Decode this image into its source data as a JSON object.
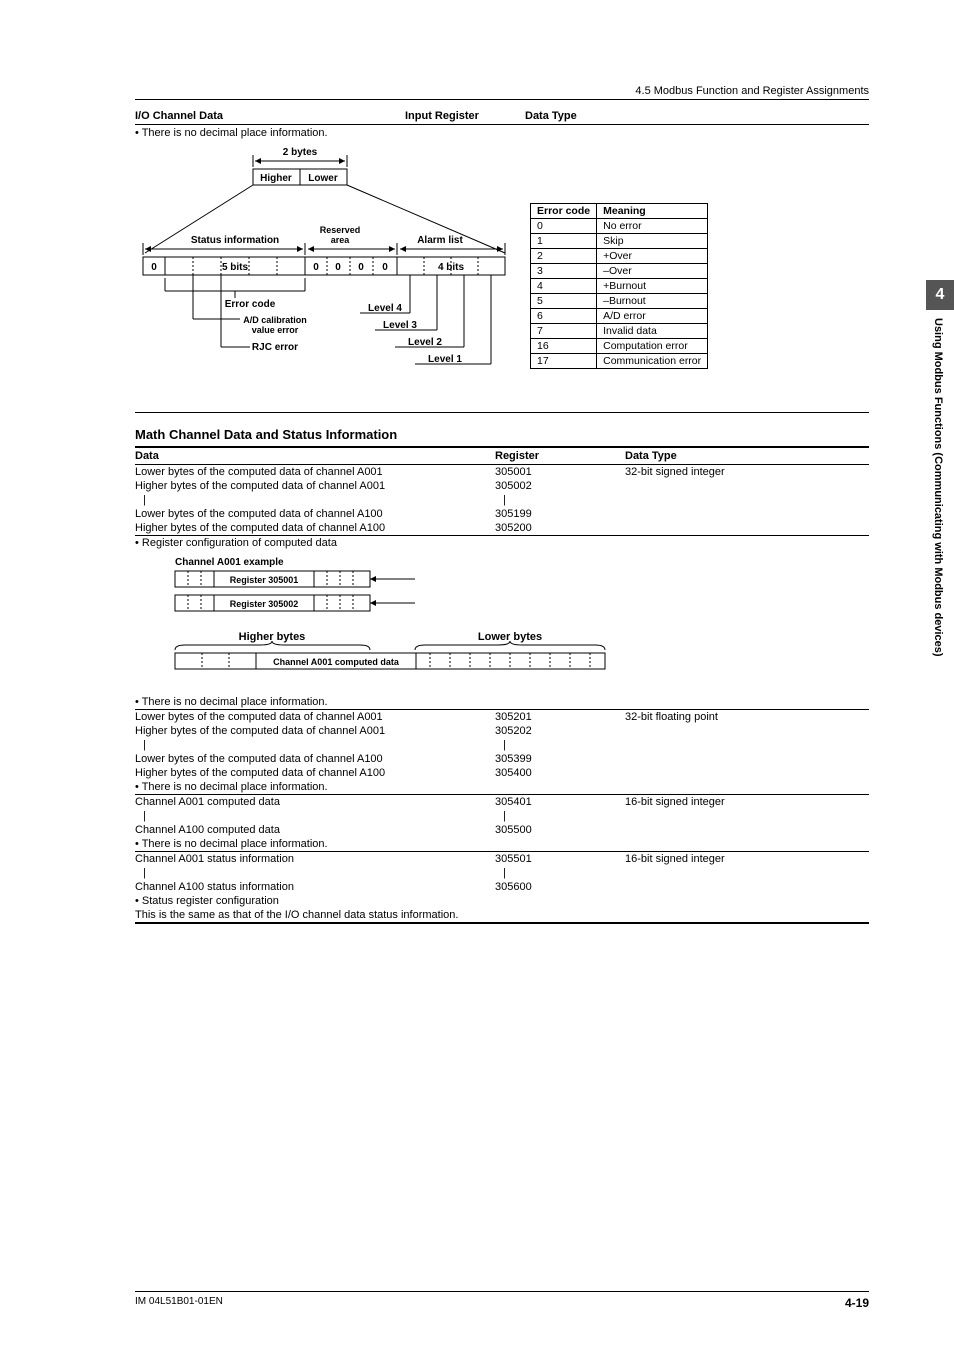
{
  "header": {
    "section_ref": "4.5  Modbus Function and Register Assignments"
  },
  "side_tab": {
    "number": "4",
    "label": "Using Modbus Functions (Communicating with Modbus devices)"
  },
  "io_section": {
    "title_col1": "I/O Channel Data",
    "title_col2": "Input Register",
    "title_col3": "Data Type",
    "note1": "• There is no decimal place information.",
    "diagram": {
      "bytes_label": "2 bytes",
      "higher": "Higher",
      "lower": "Lower",
      "status_info": "Status information",
      "reserved": "Reserved\narea",
      "alarm_list": "Alarm list",
      "bits5": "5 bits",
      "bits4": "4 bits",
      "zero": "0",
      "error_code": "Error code",
      "ad_cal": "A/D calibration\nvalue error",
      "rjc": "RJC error",
      "level1": "Level 1",
      "level2": "Level 2",
      "level3": "Level 3",
      "level4": "Level 4"
    },
    "error_table": {
      "h1": "Error code",
      "h2": "Meaning",
      "rows": [
        {
          "c": "0",
          "m": "No error"
        },
        {
          "c": "1",
          "m": "Skip"
        },
        {
          "c": "2",
          "m": "+Over"
        },
        {
          "c": "3",
          "m": "–Over"
        },
        {
          "c": "4",
          "m": "+Burnout"
        },
        {
          "c": "5",
          "m": "–Burnout"
        },
        {
          "c": "6",
          "m": "A/D error"
        },
        {
          "c": "7",
          "m": "Invalid data"
        },
        {
          "c": "16",
          "m": "Computation error"
        },
        {
          "c": "17",
          "m": "Communication error"
        }
      ]
    }
  },
  "math_section": {
    "heading": "Math Channel Data and Status Information",
    "hdr": {
      "c1": "Data",
      "c2": "Register",
      "c3": "Data Type"
    },
    "block1": {
      "r1": {
        "d": "Lower bytes of the computed data of channel A001",
        "reg": "305001",
        "type": "32-bit signed integer"
      },
      "r2": {
        "d": "Higher bytes of the computed data of channel A001",
        "reg": "305002"
      },
      "r3": {
        "d": "Lower bytes of the computed data of channel A100",
        "reg": "305199"
      },
      "r4": {
        "d": "Higher bytes of the computed data of channel A100",
        "reg": "305200"
      },
      "note": "• Register configuration of computed data"
    },
    "diagram2": {
      "title": "Channel A001 example",
      "reg1": "Register 305001",
      "reg2": "Register 305002",
      "higher": "Higher bytes",
      "lower": "Lower bytes",
      "computed": "Channel A001 computed data"
    },
    "note_decimal": "• There is no decimal place information.",
    "block2": {
      "r1": {
        "d": "Lower bytes of the computed data of channel A001",
        "reg": "305201",
        "type": "32-bit floating point"
      },
      "r2": {
        "d": "Higher bytes of the computed data of channel A001",
        "reg": "305202"
      },
      "r3": {
        "d": "Lower bytes of the computed data of channel A100",
        "reg": "305399"
      },
      "r4": {
        "d": "Higher bytes of the computed data of channel A100",
        "reg": "305400"
      }
    },
    "block3": {
      "r1": {
        "d": "Channel A001 computed data",
        "reg": "305401",
        "type": "16-bit signed integer"
      },
      "r2": {
        "d": "Channel A100 computed data",
        "reg": "305500"
      }
    },
    "block4": {
      "r1": {
        "d": "Channel A001 status information",
        "reg": "305501",
        "type": "16-bit signed integer"
      },
      "r2": {
        "d": "Channel A100 status information",
        "reg": "305600"
      },
      "note1": "• Status register configuration",
      "note2": "  This is the same as that of the I/O channel data status information."
    }
  },
  "footer": {
    "doc_id": "IM 04L51B01-01EN",
    "page": "4-19"
  },
  "ellipsis": "|"
}
